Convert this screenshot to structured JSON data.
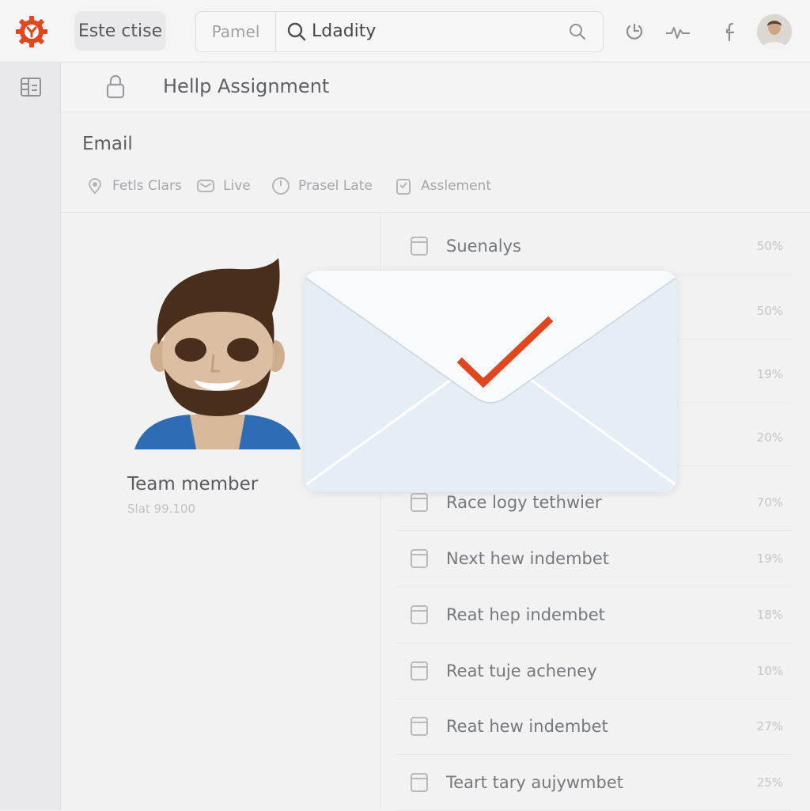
{
  "topbar": {
    "workspace_label": "Este ctise",
    "search_scope": "Pamel",
    "search_value": "Ldadity",
    "icons": [
      "logo-icon",
      "search-icon",
      "refresh-icon",
      "activity-icon",
      "facebook-icon",
      "avatar"
    ]
  },
  "header": {
    "title": "Hellp Assignment"
  },
  "section": {
    "title": "Email",
    "filters": [
      {
        "label": "Fetls Clars",
        "icon": "location-icon"
      },
      {
        "label": "Live",
        "icon": "mail-icon"
      },
      {
        "label": "Prasel Late",
        "icon": "clock-icon"
      },
      {
        "label": "Asslement",
        "icon": "clipboard-icon"
      }
    ]
  },
  "member": {
    "name": "Team member",
    "sub": "Slat 99.100"
  },
  "list": {
    "items": [
      {
        "label": "Suenalys",
        "pct": "50%"
      },
      {
        "label": "",
        "pct": "50%"
      },
      {
        "label": "",
        "pct": "19%"
      },
      {
        "label": "",
        "pct": "20%"
      },
      {
        "label": "Race logy tethwier",
        "pct": "70%"
      },
      {
        "label": "Next hew indembet",
        "pct": "19%"
      },
      {
        "label": "Reat hep indembet",
        "pct": "18%"
      },
      {
        "label": "Reat tuje acheney",
        "pct": "10%"
      },
      {
        "label": "Reat hew indembet",
        "pct": "27%"
      },
      {
        "label": "Teart tary aujywmbet",
        "pct": "25%"
      }
    ]
  },
  "colors": {
    "accent": "#e2461f",
    "avatar_shirt": "#2e6db5",
    "hair": "#4a2e1c",
    "skin": "#d8b89a"
  }
}
